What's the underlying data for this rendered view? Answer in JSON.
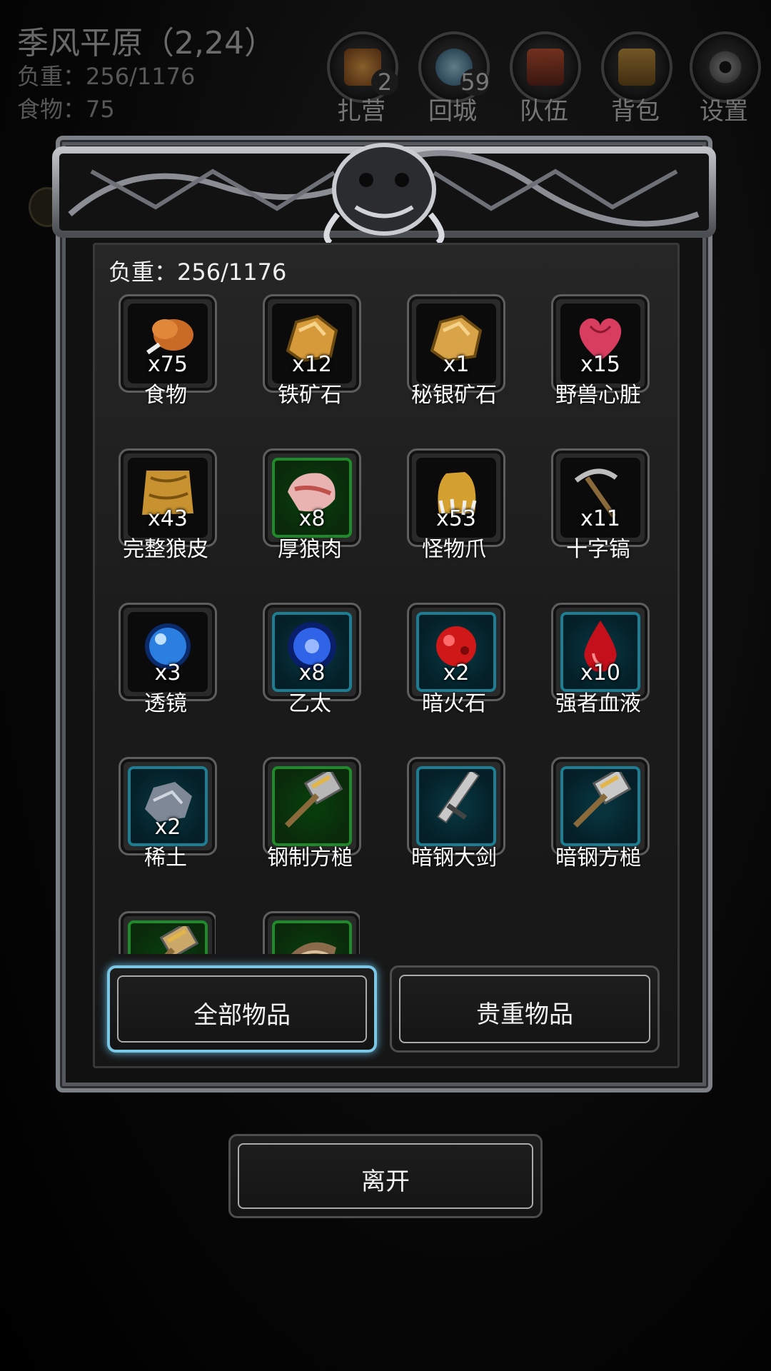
{
  "hud": {
    "location": "季风平原（2,24）",
    "weight": "负重：256/1176",
    "food": "食物：75",
    "buttons": [
      {
        "label": "扎营",
        "count": "2",
        "icon": "campfire-icon"
      },
      {
        "label": "回城",
        "count": "59",
        "icon": "portal-icon"
      },
      {
        "label": "队伍",
        "count": "",
        "icon": "team-icon"
      },
      {
        "label": "背包",
        "count": "",
        "icon": "backpack-icon"
      },
      {
        "label": "设置",
        "count": "",
        "icon": "gear-icon"
      }
    ]
  },
  "panel": {
    "weight": "负重：256/1176",
    "items": [
      {
        "name": "食物",
        "qty": "x75",
        "frame": "gray",
        "icon": "drumstick-icon",
        "color": "#c96a25"
      },
      {
        "name": "铁矿石",
        "qty": "x12",
        "frame": "gray",
        "icon": "ore-icon",
        "color": "#d79a3a"
      },
      {
        "name": "秘银矿石",
        "qty": "x1",
        "frame": "gray",
        "icon": "ore-icon",
        "color": "#d9a447"
      },
      {
        "name": "野兽心脏",
        "qty": "x15",
        "frame": "gray",
        "icon": "heart-icon",
        "color": "#d83c5f"
      },
      {
        "name": "完整狼皮",
        "qty": "x43",
        "frame": "gray",
        "icon": "pelt-icon",
        "color": "#c7922f"
      },
      {
        "name": "厚狼肉",
        "qty": "x8",
        "frame": "green",
        "icon": "meat-icon",
        "color": "#e8b3b0"
      },
      {
        "name": "怪物爪",
        "qty": "x53",
        "frame": "gray",
        "icon": "claw-icon",
        "color": "#d4a030"
      },
      {
        "name": "十字镐",
        "qty": "x11",
        "frame": "gray",
        "icon": "pickaxe-icon",
        "color": "#9a9a9a"
      },
      {
        "name": "透镜",
        "qty": "x3",
        "frame": "gray",
        "icon": "lens-icon",
        "color": "#2a7fe0"
      },
      {
        "name": "乙太",
        "qty": "x8",
        "frame": "teal",
        "icon": "ether-icon",
        "color": "#2f63e8"
      },
      {
        "name": "暗火石",
        "qty": "x2",
        "frame": "teal",
        "icon": "firestone-icon",
        "color": "#d01818"
      },
      {
        "name": "强者血液",
        "qty": "x10",
        "frame": "teal",
        "icon": "blood-drop-icon",
        "color": "#c4101a"
      },
      {
        "name": "稀土",
        "qty": "x2",
        "frame": "teal",
        "icon": "rare-earth-icon",
        "color": "#7f8896"
      },
      {
        "name": "钢制方槌",
        "qty": "",
        "frame": "green",
        "icon": "hammer-icon",
        "color": "#b7b7b7"
      },
      {
        "name": "暗钢大剑",
        "qty": "",
        "frame": "teal",
        "icon": "greatsword-icon",
        "color": "#c8c8c8"
      },
      {
        "name": "暗钢方槌",
        "qty": "",
        "frame": "teal",
        "icon": "hammer-icon",
        "color": "#c9c9c9"
      },
      {
        "name": "",
        "qty": "",
        "frame": "green",
        "icon": "hammer-icon",
        "color": "#c9a86a"
      },
      {
        "name": "",
        "qty": "",
        "frame": "green",
        "icon": "scroll-icon",
        "color": "#8a6a4a"
      }
    ],
    "tabs": {
      "all": "全部物品",
      "valuable": "贵重物品"
    },
    "leave": "离开"
  },
  "colors": {
    "selected_tab": "#7cc7e6",
    "green_frame": "#1f8a2a",
    "teal_frame": "#1c7e93"
  }
}
